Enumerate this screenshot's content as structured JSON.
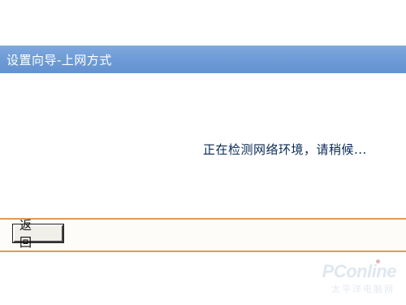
{
  "window": {
    "title": "设置向导-上网方式"
  },
  "main": {
    "status_text": "正在检测网络环境，请稍候..."
  },
  "footer": {
    "back_label": "返 回"
  },
  "watermark": {
    "brand": "PConline",
    "sub": "太平洋电脑网"
  },
  "colors": {
    "title_bar": "#6e9bd6",
    "divider": "#e49a4d",
    "status_text": "#0a2a55"
  }
}
